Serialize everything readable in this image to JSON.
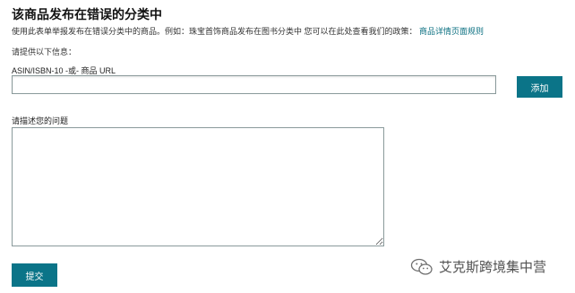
{
  "header": {
    "title": "该商品发布在错误的分类中"
  },
  "description": {
    "text": "使用此表单举报发布在错误分类中的商品。例如：珠宝首饰商品发布在图书分类中 您可以在此处查看我们的政策：",
    "link_label": "商品详情页面规则"
  },
  "form": {
    "instruction": "请提供以下信息：",
    "asin_label": "ASIN/ISBN-10 -或- 商品 URL",
    "asin_value": "",
    "add_label": "添加",
    "problem_label": "请描述您的问题",
    "problem_value": "",
    "submit_label": "提交"
  },
  "watermark": {
    "text": "艾克斯跨境集中营",
    "icon": "wechat-icon"
  },
  "colors": {
    "accent": "#0b7488",
    "link": "#0a6f80"
  }
}
